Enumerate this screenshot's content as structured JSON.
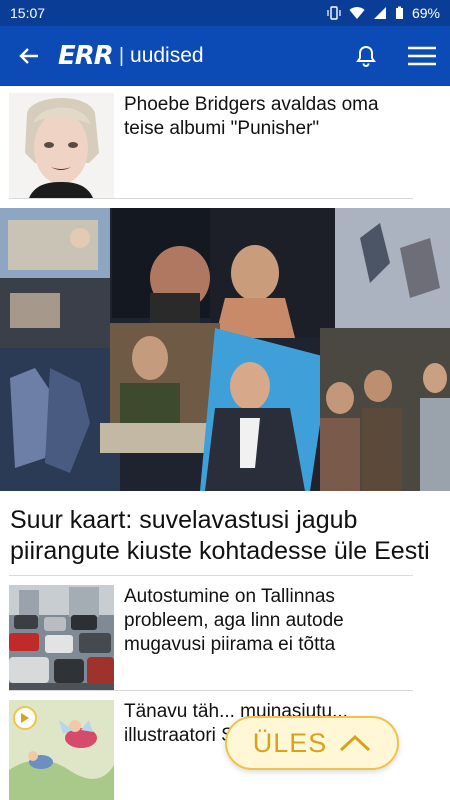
{
  "status": {
    "time": "15:07",
    "battery": "69%"
  },
  "appbar": {
    "logo": "ERR",
    "section": "uudised",
    "back_icon": "arrow-left-icon",
    "bell_icon": "bell-icon",
    "menu_icon": "hamburger-icon"
  },
  "articles": [
    {
      "title": "Phoebe Bridgers avaldas oma teise albumi \"Punisher\""
    },
    {
      "title": "Suur kaart: suvelavastusi jagub piirangute kiuste kohtadesse üle Eesti"
    },
    {
      "title": "Autostumine on Tallinnas probleem, aga linn autode mugavusi piirama ei tõtta"
    },
    {
      "title": "Tänavu täh... muinasjutu... illustraatori Siima Škopi 100...."
    }
  ],
  "fab": {
    "label": "ÜLES"
  },
  "colors": {
    "appbar": "#0c4bb5",
    "statusbar": "#0a3d96",
    "fab_bg": "#fff7d6",
    "fab_accent": "#d9a21b"
  }
}
